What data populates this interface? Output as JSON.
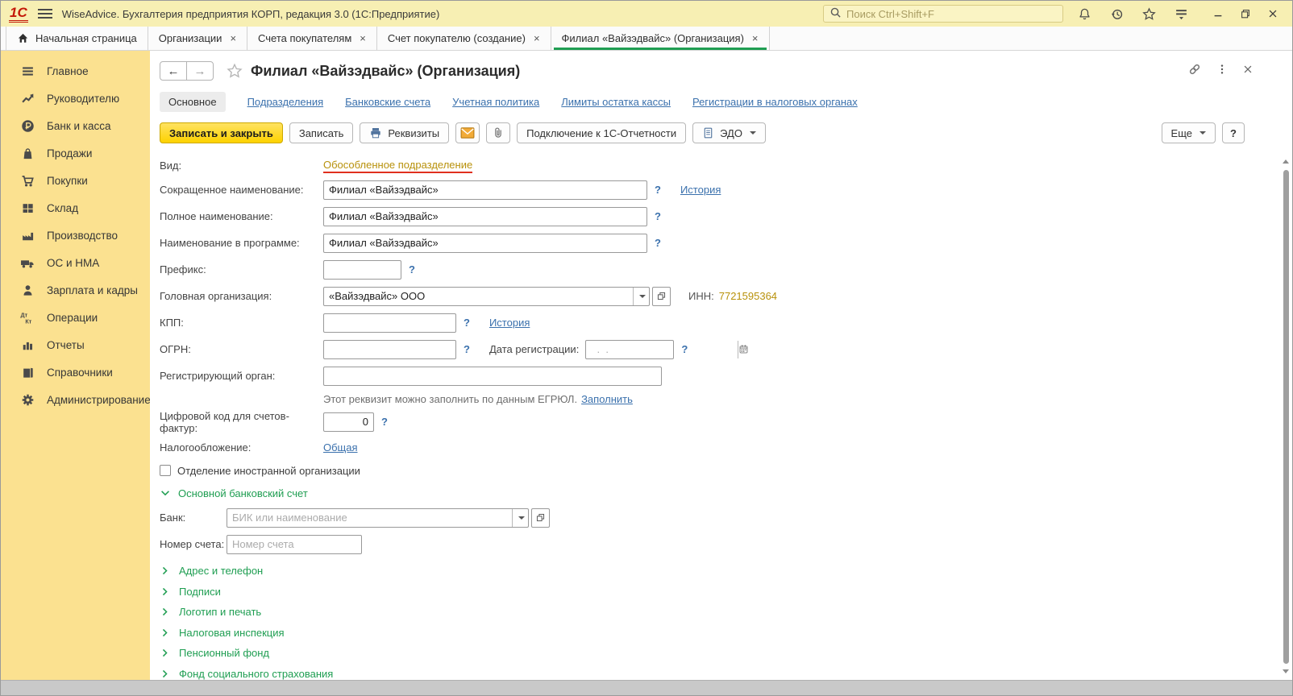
{
  "colors": {
    "green": "#1f9e52",
    "link": "#3b71ad",
    "gold": "#b8910b",
    "red": "#e0301e"
  },
  "window": {
    "title": "WiseAdvice. Бухгалтерия предприятия КОРП, редакция 3.0  (1С:Предприятие)",
    "search_placeholder": "Поиск Ctrl+Shift+F"
  },
  "tabs": [
    {
      "key": "home",
      "label": "Начальная страница",
      "icon": "home",
      "closable": false,
      "active": false
    },
    {
      "key": "organizations",
      "label": "Организации",
      "closable": true,
      "active": false
    },
    {
      "key": "customer-invoices",
      "label": "Счета покупателям",
      "closable": true,
      "active": false
    },
    {
      "key": "customer-invoice-new",
      "label": "Счет покупателю (создание)",
      "closable": true,
      "active": false
    },
    {
      "key": "branch-org",
      "label": "Филиал «Вайзэдвайс» (Организация)",
      "closable": true,
      "active": true
    }
  ],
  "tab_close_glyph": "×",
  "sidebar": {
    "items": [
      {
        "key": "main",
        "label": "Главное",
        "icon": "menu"
      },
      {
        "key": "manager",
        "label": "Руководителю",
        "icon": "trend"
      },
      {
        "key": "bank-cash",
        "label": "Банк и касса",
        "icon": "ruble"
      },
      {
        "key": "sales",
        "label": "Продажи",
        "icon": "bag"
      },
      {
        "key": "purchases",
        "label": "Покупки",
        "icon": "cart"
      },
      {
        "key": "warehouse",
        "label": "Склад",
        "icon": "grid"
      },
      {
        "key": "production",
        "label": "Производство",
        "icon": "factory"
      },
      {
        "key": "fixed-assets",
        "label": "ОС и НМА",
        "icon": "truck"
      },
      {
        "key": "payroll-hr",
        "label": "Зарплата и кадры",
        "icon": "person"
      },
      {
        "key": "operations",
        "label": "Операции",
        "icon": "dtkt"
      },
      {
        "key": "reports",
        "label": "Отчеты",
        "icon": "chart"
      },
      {
        "key": "directories",
        "label": "Справочники",
        "icon": "books"
      },
      {
        "key": "administration",
        "label": "Администрирование",
        "icon": "gear"
      }
    ]
  },
  "page": {
    "title": "Филиал «Вайзэдвайс» (Организация)",
    "nav": [
      {
        "key": "main",
        "label": "Основное",
        "active": true
      },
      {
        "key": "departments",
        "label": "Подразделения",
        "active": false
      },
      {
        "key": "bank-accounts",
        "label": "Банковские счета",
        "active": false
      },
      {
        "key": "accounting-policy",
        "label": "Учетная политика",
        "active": false
      },
      {
        "key": "cash-limits",
        "label": "Лимиты остатка кассы",
        "active": false
      },
      {
        "key": "tax-registrations",
        "label": "Регистрации в налоговых органах",
        "active": false
      }
    ],
    "toolbar": {
      "save_close": "Записать и закрыть",
      "save": "Записать",
      "requisites": "Реквизиты",
      "connect_1c": "Подключение к 1С-Отчетности",
      "edo": "ЭДО",
      "more": "Еще",
      "help": "?"
    },
    "form": {
      "help_mark": "?",
      "vid_label": "Вид:",
      "vid_value": "Обособленное подразделение",
      "short_name_label": "Сокращенное наименование:",
      "short_name_value": "Филиал «Вайзэдвайс»",
      "history_link": "История",
      "full_name_label": "Полное наименование:",
      "full_name_value": "Филиал «Вайзэдвайс»",
      "program_name_label": "Наименование в программе:",
      "program_name_value": "Филиал «Вайзэдвайс»",
      "prefix_label": "Префикс:",
      "head_org_label": "Головная организация:",
      "head_org_value": "«Вайзэдвайс» ООО",
      "inn_label": "ИНН:",
      "inn_value": "7721595364",
      "kpp_label": "КПП:",
      "kpp_history_link": "История",
      "ogrn_label": "ОГРН:",
      "reg_date_label": "Дата регистрации:",
      "reg_date_placeholder": "  .  .",
      "reg_organ_label": "Регистрирующий орган:",
      "egrul_hint": "Этот реквизит можно заполнить по данным ЕГРЮЛ.",
      "egrul_link": "Заполнить",
      "digit_code_label": "Цифровой код для счетов-фактур:",
      "digit_code_value": "0",
      "tax_label": "Налогообложение:",
      "tax_value": "Общая",
      "foreign_checkbox_label": "Отделение иностранной организации",
      "bank_section_title": "Основной банковский счет",
      "bank_label": "Банк:",
      "bank_placeholder": "БИК или наименование",
      "account_label": "Номер счета:",
      "account_placeholder": "Номер счета",
      "sections": [
        {
          "key": "address-phone",
          "label": "Адрес и телефон"
        },
        {
          "key": "signatures",
          "label": "Подписи"
        },
        {
          "key": "logo-seal",
          "label": "Логотип и печать"
        },
        {
          "key": "tax-inspection",
          "label": "Налоговая инспекция"
        },
        {
          "key": "pension-fund",
          "label": "Пенсионный фонд"
        },
        {
          "key": "social-insurance",
          "label": "Фонд социального страхования"
        }
      ]
    }
  }
}
